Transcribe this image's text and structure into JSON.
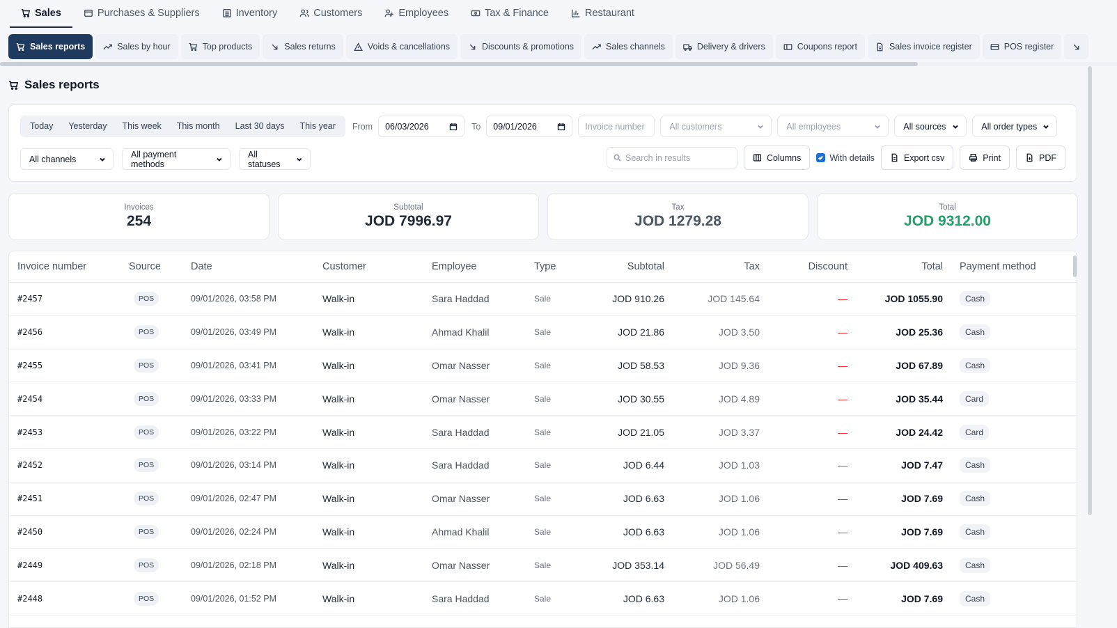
{
  "modules": [
    {
      "label": "Sales",
      "icon": "cart-icon",
      "active": true
    },
    {
      "label": "Purchases & Suppliers",
      "icon": "box-icon"
    },
    {
      "label": "Inventory",
      "icon": "inventory-icon"
    },
    {
      "label": "Customers",
      "icon": "users-icon"
    },
    {
      "label": "Employees",
      "icon": "employees-icon"
    },
    {
      "label": "Tax & Finance",
      "icon": "banknote-icon"
    },
    {
      "label": "Restaurant",
      "icon": "chart-icon"
    }
  ],
  "reports": [
    {
      "label": "Sales reports",
      "icon": "cart-icon",
      "active": true
    },
    {
      "label": "Sales by hour",
      "icon": "trend-icon"
    },
    {
      "label": "Top products",
      "icon": "cart-icon"
    },
    {
      "label": "Sales returns",
      "icon": "arrow-down-right-icon"
    },
    {
      "label": "Voids & cancellations",
      "icon": "warning-icon"
    },
    {
      "label": "Discounts & promotions",
      "icon": "arrow-down-right-icon"
    },
    {
      "label": "Sales channels",
      "icon": "trend-icon"
    },
    {
      "label": "Delivery & drivers",
      "icon": "truck-icon"
    },
    {
      "label": "Coupons report",
      "icon": "ticket-icon"
    },
    {
      "label": "Sales invoice register",
      "icon": "file-icon"
    },
    {
      "label": "POS register",
      "icon": "register-icon"
    }
  ],
  "page_title": "Sales reports",
  "filters": {
    "quick_ranges": [
      "Today",
      "Yesterday",
      "This week",
      "This month",
      "Last 30 days",
      "This year"
    ],
    "from_label": "From",
    "from_value": "06/03/2026",
    "to_label": "To",
    "to_value": "09/01/2026",
    "invoice_placeholder": "Invoice number",
    "customers": "All customers",
    "employees": "All employees",
    "sources": "All sources",
    "order_types": "All order types",
    "channels": "All channels",
    "payment_methods": "All payment methods",
    "statuses": "All statuses",
    "search_placeholder": "Search in results",
    "columns_label": "Columns",
    "with_details_label": "With details",
    "with_details_checked": true,
    "export_label": "Export csv",
    "print_label": "Print",
    "pdf_label": "PDF"
  },
  "summary": {
    "invoices_label": "Invoices",
    "invoices_value": "254",
    "subtotal_label": "Subtotal",
    "subtotal_value": "JOD 7996.97",
    "tax_label": "Tax",
    "tax_value": "JOD 1279.28",
    "total_label": "Total",
    "total_value": "JOD 9312.00",
    "total_color": "#22a06b"
  },
  "table": {
    "headers": [
      "Invoice number",
      "Source",
      "Date",
      "Customer",
      "Employee",
      "Type",
      "Subtotal",
      "Tax",
      "Discount",
      "Total",
      "Payment method"
    ],
    "rows": [
      {
        "invoice": "#2457",
        "source": "POS",
        "date": "09/01/2026, 03:58 PM",
        "customer": "Walk-in",
        "employee": "Sara Haddad",
        "type": "Sale",
        "subtotal": "JOD 910.26",
        "tax": "JOD 145.64",
        "discount": "—",
        "total": "JOD 1055.90",
        "payment": "Cash"
      },
      {
        "invoice": "#2456",
        "source": "POS",
        "date": "09/01/2026, 03:49 PM",
        "customer": "Walk-in",
        "employee": "Ahmad Khalil",
        "type": "Sale",
        "subtotal": "JOD 21.86",
        "tax": "JOD 3.50",
        "discount": "—",
        "total": "JOD 25.36",
        "payment": "Cash"
      },
      {
        "invoice": "#2455",
        "source": "POS",
        "date": "09/01/2026, 03:41 PM",
        "customer": "Walk-in",
        "employee": "Omar Nasser",
        "type": "Sale",
        "subtotal": "JOD 58.53",
        "tax": "JOD 9.36",
        "discount": "—",
        "total": "JOD 67.89",
        "payment": "Cash"
      },
      {
        "invoice": "#2454",
        "source": "POS",
        "date": "09/01/2026, 03:33 PM",
        "customer": "Walk-in",
        "employee": "Omar Nasser",
        "type": "Sale",
        "subtotal": "JOD 30.55",
        "tax": "JOD 4.89",
        "discount": "—",
        "total": "JOD 35.44",
        "payment": "Card"
      },
      {
        "invoice": "#2453",
        "source": "POS",
        "date": "09/01/2026, 03:22 PM",
        "customer": "Walk-in",
        "employee": "Sara Haddad",
        "type": "Sale",
        "subtotal": "JOD 21.05",
        "tax": "JOD 3.37",
        "discount": "—",
        "total": "JOD 24.42",
        "payment": "Card"
      },
      {
        "invoice": "#2452",
        "source": "POS",
        "date": "09/01/2026, 03:14 PM",
        "customer": "Walk-in",
        "employee": "Sara Haddad",
        "type": "Sale",
        "subtotal": "JOD 6.44",
        "tax": "JOD 1.03",
        "discount": "—",
        "total": "JOD 7.47",
        "payment": "Cash"
      },
      {
        "invoice": "#2451",
        "source": "POS",
        "date": "09/01/2026, 02:47 PM",
        "customer": "Walk-in",
        "employee": "Omar Nasser",
        "type": "Sale",
        "subtotal": "JOD 6.63",
        "tax": "JOD 1.06",
        "discount": "—",
        "total": "JOD 7.69",
        "payment": "Cash"
      },
      {
        "invoice": "#2450",
        "source": "POS",
        "date": "09/01/2026, 02:24 PM",
        "customer": "Walk-in",
        "employee": "Ahmad Khalil",
        "type": "Sale",
        "subtotal": "JOD 6.63",
        "tax": "JOD 1.06",
        "discount": "—",
        "total": "JOD 7.69",
        "payment": "Cash"
      },
      {
        "invoice": "#2449",
        "source": "POS",
        "date": "09/01/2026, 02:18 PM",
        "customer": "Walk-in",
        "employee": "Omar Nasser",
        "type": "Sale",
        "subtotal": "JOD 353.14",
        "tax": "JOD 56.49",
        "discount": "—",
        "total": "JOD 409.63",
        "payment": "Cash"
      },
      {
        "invoice": "#2448",
        "source": "POS",
        "date": "09/01/2026, 01:52 PM",
        "customer": "Walk-in",
        "employee": "Sara Haddad",
        "type": "Sale",
        "subtotal": "JOD 6.63",
        "tax": "JOD 1.06",
        "discount": "—",
        "total": "JOD 7.69",
        "payment": "Cash"
      }
    ]
  },
  "colors": {
    "accent_active_tab": "#1e3a5f",
    "discount_dash": "#dc2626",
    "total_green": "#22a06b",
    "checkbox_blue": "#1d6fd8"
  }
}
